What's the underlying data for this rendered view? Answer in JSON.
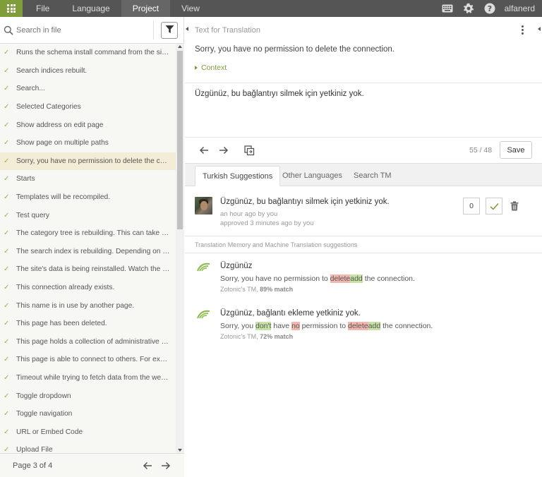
{
  "topbar": {
    "menu": [
      "File",
      "Language",
      "Project",
      "View"
    ],
    "active_menu": "Project",
    "username": "alfanerd",
    "icons": [
      "grid-icon",
      "keyboard-icon",
      "gear-icon",
      "help-icon"
    ]
  },
  "sidebar": {
    "search_placeholder": "Search in file",
    "items": [
      "Runs the schema install command from the site's root directory",
      "Search indices rebuilt.",
      "Search...",
      "Selected Categories",
      "Show address on edit page",
      "Show page on multiple paths",
      "Sorry, you have no permission to delete the connection.",
      "Starts",
      "Templates will be recompiled.",
      "Test query",
      "The category tree is rebuilding. This can take a while.",
      "The search index is rebuilding. Depending on the number of pages",
      "The site's data is being reinstalled. Watch the console",
      "This connection already exists.",
      "This name is in use by another page.",
      "This page has been deleted.",
      "This page holds a collection of administrative options",
      "This page is able to connect to others. For example",
      "Timeout while trying to fetch data from the website",
      "Toggle dropdown",
      "Toggle navigation",
      "URL or Embed Code",
      "Upload File"
    ],
    "selected_index": 6,
    "pagination": "Page 3 of 4"
  },
  "source": {
    "header": "Text for Translation",
    "text": "Sorry, you have no permission to delete the connection.",
    "context_label": "Context"
  },
  "editor": {
    "value": "Üzgünüz, bu bağlantıyı silmek için yetkiniz yok.",
    "counter": "55 / 48",
    "save_label": "Save"
  },
  "tabs": [
    "Turkish Suggestions",
    "Other Languages",
    "Search TM"
  ],
  "suggestion": {
    "text": "Üzgünüz, bu bağlantıyı silmek için yetkiniz yok.",
    "meta1": "an hour ago by you",
    "meta2": "approved 3 minutes ago by you",
    "votes": "0"
  },
  "tm": {
    "header": "Translation Memory and Machine Translation suggestions",
    "entries": [
      {
        "title": "Üzgünüz",
        "src": {
          "before": "Sorry, you have no permission to ",
          "del": "delete",
          "ins": "add",
          "after": " the connection."
        },
        "info": "Zotonic's TM,",
        "match": "89% match"
      },
      {
        "title": "Üzgünüz, bağlantı ekleme yetkiniz yok.",
        "src": {
          "p1": "Sorry, you ",
          "ins1": "don't",
          "p2": " have ",
          "del1": "no",
          "p3": " permission to ",
          "del2": "delete",
          "ins2": "add",
          "p4": " the connection."
        },
        "info": "Zotonic's TM,",
        "match": "72% match"
      }
    ]
  },
  "colors": {
    "accent": "#7f9e3b",
    "topbar": "#555555",
    "selected_row": "#f3ecd6",
    "diff_deleted": "#f2b8b0",
    "diff_inserted": "#c8e2a6"
  }
}
